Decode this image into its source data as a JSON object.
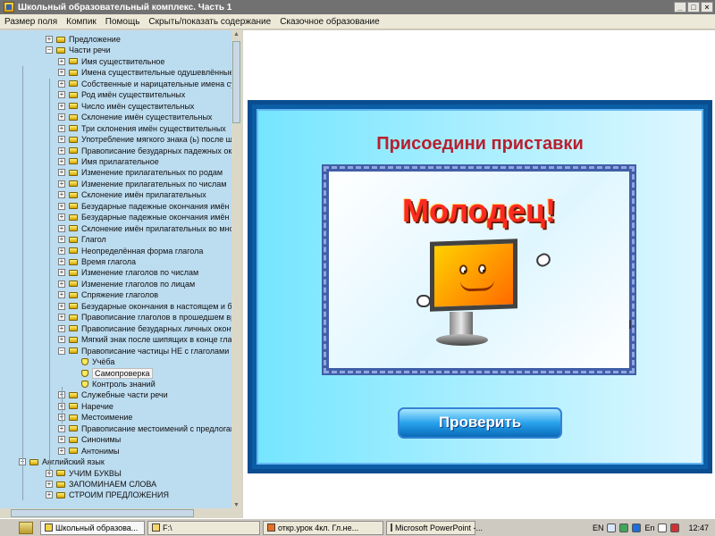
{
  "window": {
    "title": "Школьный образовательный комплекс. Часть 1"
  },
  "menu": [
    "Размер поля",
    "Компик",
    "Помощь",
    "Скрыть/показать содержание",
    "Сказочное образование"
  ],
  "tree": [
    {
      "label": "Предложение",
      "level": 1,
      "toggle": "+"
    },
    {
      "label": "Части речи",
      "level": 1,
      "toggle": "−"
    },
    {
      "label": "Имя существительное",
      "level": 2,
      "toggle": "+"
    },
    {
      "label": "Имена существительные одушевлённые и",
      "level": 2,
      "toggle": "+"
    },
    {
      "label": "Собственные и нарицательные имена сущ",
      "level": 2,
      "toggle": "+"
    },
    {
      "label": "Род имён существительных",
      "level": 2,
      "toggle": "+"
    },
    {
      "label": "Число имён существительных",
      "level": 2,
      "toggle": "+"
    },
    {
      "label": "Склонение имён существительных",
      "level": 2,
      "toggle": "+"
    },
    {
      "label": "Три склонения имён существительных",
      "level": 2,
      "toggle": "+"
    },
    {
      "label": "Употребление мягкого знака (ь) после ш",
      "level": 2,
      "toggle": "+"
    },
    {
      "label": "Правописание безударных падежных окон",
      "level": 2,
      "toggle": "+"
    },
    {
      "label": "Имя прилагательное",
      "level": 2,
      "toggle": "+"
    },
    {
      "label": "Изменение прилагательных по родам",
      "level": 2,
      "toggle": "+"
    },
    {
      "label": "Изменение прилагательных по числам",
      "level": 2,
      "toggle": "+"
    },
    {
      "label": "Склонение имён прилагательных",
      "level": 2,
      "toggle": "+"
    },
    {
      "label": "Безударные падежные окончания имён п",
      "level": 2,
      "toggle": "+"
    },
    {
      "label": "Безударные падежные окончания имён п",
      "level": 2,
      "toggle": "+"
    },
    {
      "label": "Склонение имён прилагательных во множ",
      "level": 2,
      "toggle": "+"
    },
    {
      "label": "Глагол",
      "level": 2,
      "toggle": "+"
    },
    {
      "label": "Неопределённая форма глагола",
      "level": 2,
      "toggle": "+"
    },
    {
      "label": "Время глагола",
      "level": 2,
      "toggle": "+"
    },
    {
      "label": "Изменение глаголов по числам",
      "level": 2,
      "toggle": "+"
    },
    {
      "label": "Изменение глаголов по лицам",
      "level": 2,
      "toggle": "+"
    },
    {
      "label": "Спряжение глаголов",
      "level": 2,
      "toggle": "+"
    },
    {
      "label": "Безударные окончания в настоящем и бу",
      "level": 2,
      "toggle": "+"
    },
    {
      "label": "Правописание глаголов в прошедшем вре",
      "level": 2,
      "toggle": "+"
    },
    {
      "label": "Правописание безударных личных оконча",
      "level": 2,
      "toggle": "+"
    },
    {
      "label": "Мягкий знак после шипящих в конце глаг",
      "level": 2,
      "toggle": "+"
    },
    {
      "label": "Правописание частицы НЕ с глаголами",
      "level": 2,
      "toggle": "−"
    },
    {
      "label": "Учёба",
      "level": 3,
      "toggle": ""
    },
    {
      "label": "Самопроверка",
      "level": 3,
      "toggle": "",
      "selected": true
    },
    {
      "label": "Контроль знаний",
      "level": 3,
      "toggle": ""
    },
    {
      "label": "Служебные части речи",
      "level": 2,
      "toggle": "+"
    },
    {
      "label": "Наречие",
      "level": 2,
      "toggle": "+"
    },
    {
      "label": "Местоимение",
      "level": 2,
      "toggle": "+"
    },
    {
      "label": "Правописание местоимений с предлогам",
      "level": 2,
      "toggle": "+"
    },
    {
      "label": "Синонимы",
      "level": 2,
      "toggle": "+"
    },
    {
      "label": "Антонимы",
      "level": 2,
      "toggle": "+"
    },
    {
      "label": "Английский язык",
      "level": 0,
      "toggle": "−"
    },
    {
      "label": "УЧИМ БУКВЫ",
      "level": 1,
      "toggle": "+"
    },
    {
      "label": "ЗАПОМИНАЕМ СЛОВА",
      "level": 1,
      "toggle": "+"
    },
    {
      "label": "СТРОИМ ПРЕДЛОЖЕНИЯ",
      "level": 1,
      "toggle": "+"
    }
  ],
  "slide": {
    "title": "Присоедини приставки",
    "message": "Молодец!",
    "button": "Проверить",
    "marker": "I"
  },
  "taskbar": {
    "items": [
      "Школьный образова...",
      "F:\\",
      "откр.урок 4кл. Гл.не...",
      "Microsoft PowerPoint -..."
    ],
    "language": "EN",
    "language2": "En",
    "time": "12:47"
  },
  "colors": {
    "accent": "#0b5ea6",
    "title_red": "#b81f2f",
    "button_blue": "#28a2ec"
  }
}
